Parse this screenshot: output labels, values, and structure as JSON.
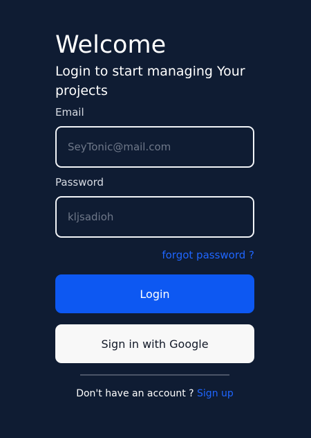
{
  "header": {
    "title": "Welcome",
    "subtitle": "Login to start managing Your projects"
  },
  "form": {
    "email": {
      "label": "Email",
      "placeholder": "SeyTonic@mail.com",
      "value": ""
    },
    "password": {
      "label": "Password",
      "placeholder": "kljsadioh",
      "value": ""
    },
    "forgot_password": "forgot password ?",
    "login_label": "Login",
    "google_label": "Sign in with Google"
  },
  "footer": {
    "account_prompt": "Don't have an account ?",
    "signup_label": "Sign up"
  },
  "colors": {
    "background": "#0f1c33",
    "primary": "#0d58f2",
    "link": "#1f66ff",
    "google_button": "#f8f8f8",
    "input_border": "#f2f4f8"
  }
}
